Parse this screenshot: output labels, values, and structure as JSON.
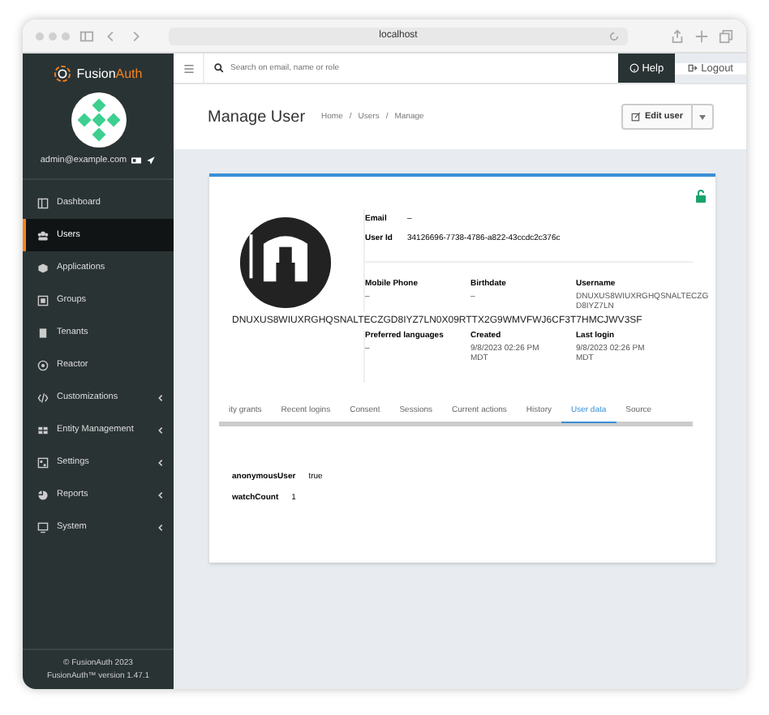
{
  "browser": {
    "url": "localhost"
  },
  "sidebar": {
    "logo": {
      "first": "Fusion",
      "second": "Auth"
    },
    "email": "admin@example.com",
    "items": [
      {
        "label": "Dashboard",
        "selected": false,
        "submenu": false
      },
      {
        "label": "Users",
        "selected": true,
        "submenu": false
      },
      {
        "label": "Applications",
        "selected": false,
        "submenu": false
      },
      {
        "label": "Groups",
        "selected": false,
        "submenu": false
      },
      {
        "label": "Tenants",
        "selected": false,
        "submenu": false
      },
      {
        "label": "Reactor",
        "selected": false,
        "submenu": false
      },
      {
        "label": "Customizations",
        "selected": false,
        "submenu": true
      },
      {
        "label": "Entity Management",
        "selected": false,
        "submenu": true
      },
      {
        "label": "Settings",
        "selected": false,
        "submenu": true
      },
      {
        "label": "Reports",
        "selected": false,
        "submenu": true
      },
      {
        "label": "System",
        "selected": false,
        "submenu": true
      }
    ],
    "footer": [
      "© FusionAuth 2023",
      "FusionAuth™ version 1.47.1"
    ]
  },
  "header": {
    "search": {
      "placeholder": "Search on email, name or role"
    },
    "help": "Help",
    "logout": "Logout"
  },
  "page": {
    "title": "Manage User",
    "breadcrumbs": [
      "Home",
      "Users",
      "Manage"
    ],
    "breadcrumb_separator": "/",
    "edit_button": "Edit user"
  },
  "user": {
    "fields": [
      {
        "label": "Email",
        "value": "–"
      },
      {
        "label": "User Id",
        "value": "34126696-7738-4786-a822-43ccdc2c376c"
      }
    ],
    "name": "DNUXUS8WIUXRGHQSNALTECZGD8IYZ7LN0X09RTTX2G9WMVFWJ6CF3T7HMCJWV3SF",
    "details_row_1": [
      {
        "label": "Mobile Phone",
        "value": "–"
      },
      {
        "label": "Birthdate",
        "value": "–"
      },
      {
        "label": "Username",
        "value": "DNUXUS8WIUXRGHQSNALTECZGD8IYZ7LN"
      }
    ],
    "details_row_2": [
      {
        "label": "Preferred languages",
        "value": "–"
      },
      {
        "label": "Created",
        "value": "9/8/2023 02:26 PM MDT"
      },
      {
        "label": "Last login",
        "value": "9/8/2023 02:26 PM MDT"
      }
    ]
  },
  "tabs": [
    {
      "label": "ity grants",
      "selected": false
    },
    {
      "label": "Recent logins",
      "selected": false
    },
    {
      "label": "Consent",
      "selected": false
    },
    {
      "label": "Sessions",
      "selected": false
    },
    {
      "label": "Current actions",
      "selected": false
    },
    {
      "label": "History",
      "selected": false
    },
    {
      "label": "User data",
      "selected": true
    },
    {
      "label": "Source",
      "selected": false
    }
  ],
  "user_data": [
    {
      "key": "anonymousUser",
      "value": "true"
    },
    {
      "key": "watchCount",
      "value": "1"
    }
  ]
}
